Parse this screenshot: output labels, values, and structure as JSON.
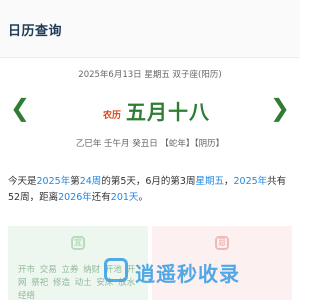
{
  "header": {
    "title": "日历查询"
  },
  "date_line": "2025年6月13日 星期五 双子座(阳历)",
  "lunar": {
    "tag": "农历",
    "date": "五月十八",
    "prev": "❮",
    "next": "❯"
  },
  "ganzhi_line": "乙巳年 壬午月 癸丑日 【蛇年】【阴历】",
  "info": {
    "p1": "今天是",
    "year": "2025年",
    "p2": "第",
    "week": "24周",
    "p3": "的第5天，6月的第3周",
    "weekday": "星期五",
    "p4": "，",
    "year2": "2025年",
    "p5": "共有52周，距离",
    "next_year": "2026年",
    "p6": "还有",
    "days_left": "201天",
    "p7": "。"
  },
  "cards": {
    "yi_badge": "宜",
    "ji_badge": "忌",
    "yi_items": [
      "开市",
      "交易",
      "立券",
      "纳财",
      "开池",
      "开",
      "网",
      "祭祀",
      "修造",
      "动土",
      "安床",
      "放水",
      "经络"
    ]
  },
  "watermark": {
    "text": "逍遥秒收录"
  },
  "colors": {
    "accent": "#2e7d32",
    "link": "#1e88e5",
    "lunar_tag": "#d84315"
  }
}
